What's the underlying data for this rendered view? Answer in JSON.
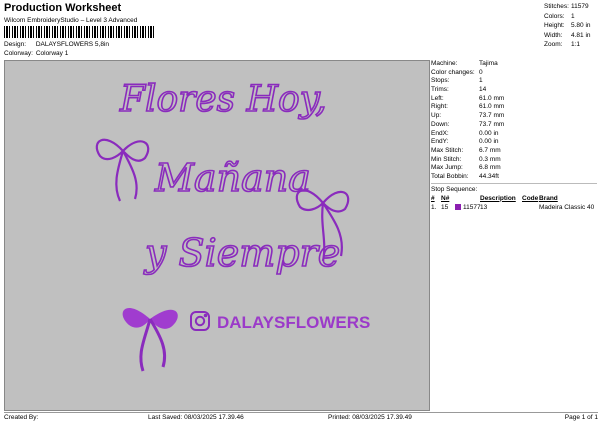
{
  "header": {
    "title": "Production Worksheet",
    "software": "Wilcom EmbroideryStudio – Level 3 Advanced"
  },
  "meta": {
    "design_label": "Design:",
    "design_value": "DALAYSFLOWERS 5,8in",
    "colorway_label": "Colorway:",
    "colorway_value": "Colorway 1"
  },
  "stats": [
    {
      "k": "Stitches:",
      "v": "11579"
    },
    {
      "k": "Colors:",
      "v": "1"
    },
    {
      "k": "Height:",
      "v": "5.80 in"
    },
    {
      "k": "Width:",
      "v": "4.81 in"
    },
    {
      "k": "Zoom:",
      "v": "1:1"
    }
  ],
  "design_text": {
    "line1": "Flores Hoy,",
    "line2": "Mañana",
    "line3": "y Siempre",
    "handle": "DALAYSFLOWERS"
  },
  "colors": {
    "thread": "#8b1fb0",
    "canvas": "#c0c0c0"
  },
  "machine": [
    {
      "k": "Machine:",
      "v": "Tajima"
    },
    {
      "k": "Color changes:",
      "v": "0"
    },
    {
      "k": "Stops:",
      "v": "1"
    },
    {
      "k": "Trims:",
      "v": "14"
    },
    {
      "k": "Left:",
      "v": "61.0 mm"
    },
    {
      "k": "Right:",
      "v": "61.0 mm"
    },
    {
      "k": "Up:",
      "v": "73.7 mm"
    },
    {
      "k": "Down:",
      "v": "73.7 mm"
    },
    {
      "k": "EndX:",
      "v": "0.00 in"
    },
    {
      "k": "EndY:",
      "v": "0.00 in"
    },
    {
      "k": "Max Stitch:",
      "v": "6.7 mm"
    },
    {
      "k": "Min Stitch:",
      "v": "0.3 mm"
    },
    {
      "k": "Max Jump:",
      "v": "6.8 mm"
    },
    {
      "k": "Total Bobbin:",
      "v": "44.34ft"
    }
  ],
  "sequence": {
    "title": "Stop Sequence:",
    "headers": [
      "#",
      "N#",
      "Description",
      "Code",
      "Brand"
    ],
    "rows": [
      {
        "num": "1.",
        "n": "15",
        "stitches": "11577",
        "desc": "13",
        "code": "",
        "brand": "Madeira Classic 40"
      }
    ]
  },
  "footer": {
    "created_by": "Created By:",
    "last_saved": "Last Saved: 08/03/2025 17.39.46",
    "printed": "Printed: 08/03/2025 17.39.49",
    "page": "Page 1 of 1"
  }
}
